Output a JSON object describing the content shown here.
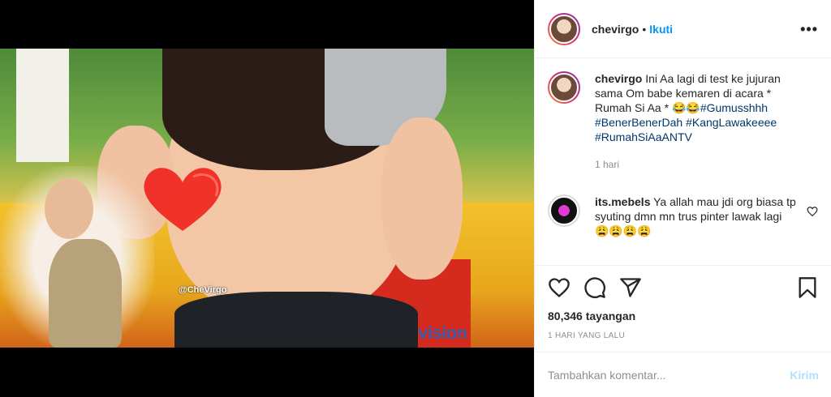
{
  "header": {
    "username": "chevirgo",
    "separator": "•",
    "follow_label": "Ikuti",
    "more_label": "•••"
  },
  "video": {
    "watermark": "@CheVirgo",
    "channel_logo": "vision"
  },
  "caption": {
    "username": "chevirgo",
    "text": "Ini Aa lagi di test ke jujuran sama Om babe kemaren di acara * Rumah Si Aa * 😂😂",
    "hashtags": [
      "#Gumusshhh",
      "#BenerBenerDah",
      "#KangLawakeeee",
      "#RumahSiAaANTV"
    ],
    "time": "1 hari"
  },
  "comments": [
    {
      "username": "its.mebels",
      "text": "Ya allah mau jdi org biasa tp syuting dmn mn trus pinter lawak lagi 😩😩😩😩"
    }
  ],
  "actions": {
    "icons": [
      "heart-icon",
      "comment-icon",
      "share-icon",
      "bookmark-icon"
    ],
    "views": "80,346 tayangan",
    "date": "1 HARI YANG LALU"
  },
  "add_comment": {
    "placeholder": "Tambahkan komentar...",
    "send_label": "Kirim"
  },
  "colors": {
    "link": "#0095f6",
    "hashtag": "#00376b",
    "muted": "#8e8e8e",
    "send_disabled": "#b2dffc"
  }
}
